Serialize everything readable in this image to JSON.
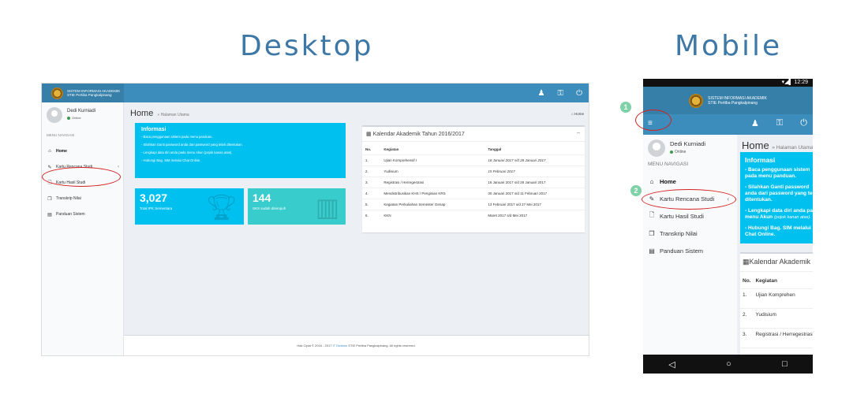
{
  "headings": {
    "desktop": "Desktop",
    "mobile": "Mobile"
  },
  "app": {
    "name_line1": "SISTEM INFORMASI AKADEMIK",
    "name_line2": "STIE Pertiba Pangkalpinang"
  },
  "user": {
    "name": "Dedi Kurniadi",
    "status": "Online"
  },
  "nav_header": "MENU NAVIGASI",
  "menu": [
    {
      "label": "Home",
      "icon": "home-icon"
    },
    {
      "label": "Kartu Rencana Studi",
      "icon": "pencil-icon"
    },
    {
      "label": "Kartu Hasil Studi",
      "icon": "file-icon"
    },
    {
      "label": "Transkrip Nilai",
      "icon": "copy-icon"
    },
    {
      "label": "Panduan Sistem",
      "icon": "book-icon"
    }
  ],
  "page": {
    "title": "Home",
    "subtitle": "» Halaman Utama",
    "crumb": "Home"
  },
  "info": {
    "title": "Informasi",
    "items": [
      "- Baca penggunaan sistem pada menu panduan.",
      "- Silahkan Ganti password anda dari password yang telah ditentukan.",
      "- Lengkapi data diri anda pada menu Akun (pojok kanan atas).",
      "- Hubungi Bag. SIM melalui Chat Online."
    ],
    "mobile_items": [
      "- Baca penggunaan sistem pada menu panduan.",
      "- Silahkan Ganti password anda dari password yang telah ditentukan.",
      "- Lengkapi data diri anda pada menu Akun",
      "- Hubungi Bag. SIM melalui Chat Online."
    ],
    "mobile_note": "(pojok kanan atas)."
  },
  "stats": [
    {
      "value": "3,027",
      "label": "Total IPK Sementara"
    },
    {
      "value": "144",
      "label": "SKS sudah ditempuh"
    }
  ],
  "calendar": {
    "title": "Kalendar Akademik Tahun 2016/2017",
    "mobile_title": "Kalendar Akademik",
    "columns": [
      "No.",
      "Kegiatan",
      "Tanggal"
    ],
    "rows": [
      {
        "no": "1.",
        "kegiatan": "Ujian Komprehensif I",
        "tanggal": "16 Januari 2017 s/d 28 Januari 2017"
      },
      {
        "no": "2.",
        "kegiatan": "Yudisium",
        "tanggal": "15 Februari 2017"
      },
      {
        "no": "3.",
        "kegiatan": "Registrasi / Herregestrasi",
        "tanggal": "16 Januari 2017 s/d 28 Januari 2017"
      },
      {
        "no": "4.",
        "kegiatan": "Mendistribusikan KHS / Pengisian KRS",
        "tanggal": "30 Januari 2017 s/d 11 Februari 2017"
      },
      {
        "no": "5.",
        "kegiatan": "Kegiatan Perkuliahan Semester Genap",
        "tanggal": "13 Februari 2017 s/d 27 Mei 2017"
      },
      {
        "no": "6.",
        "kegiatan": "KKN",
        "tanggal": "Maret 2017 s/d Mei 2017"
      }
    ],
    "mobile_rows": [
      {
        "no": "1.",
        "kegiatan": "Ujian Komprehen"
      },
      {
        "no": "2.",
        "kegiatan": "Yudisium"
      },
      {
        "no": "3.",
        "kegiatan": "Registrasi / Herregestrasi"
      }
    ]
  },
  "footer": {
    "prefix": "Hak Cipta © 2016 - 2017",
    "link": "IT Division",
    "suffix": "STIE Pertiba Pangkalpinang. All rights reserved."
  },
  "mobile_status": {
    "time": "12:29"
  },
  "callouts": [
    "1",
    "2"
  ],
  "colors": {
    "primary": "#3c8dbc",
    "info": "#00c0ef",
    "teal": "#39cccc",
    "highlight": "#d42020"
  }
}
